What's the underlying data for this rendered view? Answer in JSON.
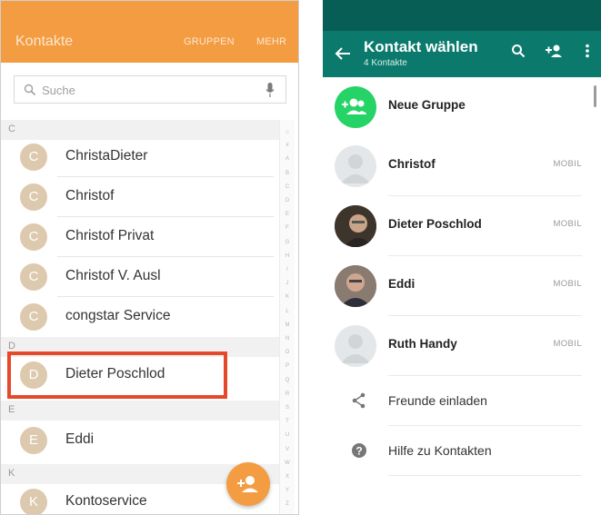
{
  "left": {
    "header": {
      "title": "Kontakte",
      "groups": "GRUPPEN",
      "more": "MEHR"
    },
    "search_placeholder": "Suche",
    "sections": [
      "C",
      "D",
      "E",
      "K"
    ],
    "contacts_c": [
      {
        "initial": "C",
        "name": "ChristaDieter"
      },
      {
        "initial": "C",
        "name": "Christof"
      },
      {
        "initial": "C",
        "name": "Christof Privat"
      },
      {
        "initial": "C",
        "name": "Christof V. Ausl"
      },
      {
        "initial": "C",
        "name": "congstar Service"
      }
    ],
    "contacts_d": [
      {
        "initial": "D",
        "name": "Dieter Poschlod"
      }
    ],
    "contacts_e": [
      {
        "initial": "E",
        "name": "Eddi"
      }
    ],
    "contacts_k": [
      {
        "initial": "K",
        "name": "Kontoservice"
      }
    ],
    "index": [
      "☆",
      "#",
      "A",
      "B",
      "C",
      "D",
      "E",
      "F",
      "G",
      "H",
      "I",
      "J",
      "K",
      "L",
      "M",
      "N",
      "O",
      "P",
      "Q",
      "R",
      "S",
      "T",
      "U",
      "V",
      "W",
      "X",
      "Y",
      "Z"
    ],
    "accent": "#f39c42",
    "highlight_color": "#e5482a"
  },
  "right": {
    "toolbar": {
      "title": "Kontakt wählen",
      "subtitle": "4 Kontakte"
    },
    "new_group": "Neue Gruppe",
    "contacts": [
      {
        "name": "Christof",
        "type": "MOBIL"
      },
      {
        "name": "Dieter Poschlod",
        "type": "MOBIL"
      },
      {
        "name": "Eddi",
        "type": "MOBIL"
      },
      {
        "name": "Ruth Handy",
        "type": "MOBIL"
      }
    ],
    "actions": {
      "invite": "Freunde einladen",
      "help": "Hilfe zu Kontakten"
    },
    "colors": {
      "status": "#075e54",
      "toolbar": "#0b7a6c",
      "green": "#25d366"
    }
  }
}
